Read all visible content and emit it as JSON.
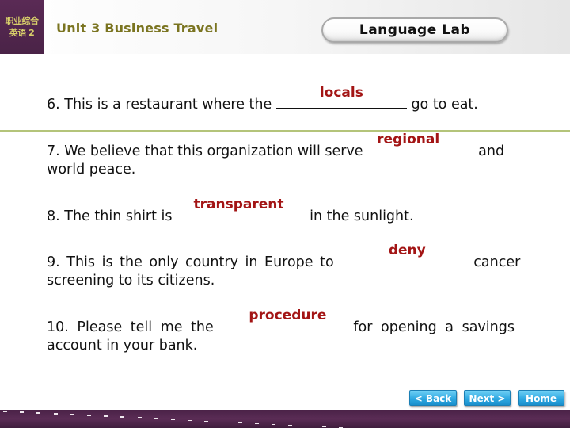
{
  "header": {
    "logo_line1": "职业综合",
    "logo_line2": "英语 2",
    "unit_title": "Unit 3 Business Travel",
    "section_label": "Language Lab"
  },
  "questions": [
    {
      "number": "6.",
      "before": "This is a restaurant where the",
      "answer": "locals",
      "after": "go to eat.",
      "continuation": ""
    },
    {
      "number": "7.",
      "before": "We believe that this organization will serve",
      "answer": "regional",
      "after": "and",
      "continuation": "world peace."
    },
    {
      "number": "8.",
      "before": "The thin shirt is",
      "answer": "transparent",
      "after": "in the sunlight.",
      "continuation": ""
    },
    {
      "number": "9.",
      "before": "This is the only country in Europe to",
      "answer": "deny",
      "after": "cancer",
      "continuation": "screening to its citizens."
    },
    {
      "number": "10.",
      "before": "Please tell me the",
      "answer": "procedure",
      "after": "for opening a savings",
      "continuation": "account in your bank."
    }
  ],
  "nav": {
    "back": "< Back",
    "next": "Next >",
    "home": "Home"
  },
  "colors": {
    "brand_purple": "#4a2347",
    "answer_red": "#a31515",
    "title_olive": "#7a7420",
    "nav_blue": "#2ea9e2"
  }
}
